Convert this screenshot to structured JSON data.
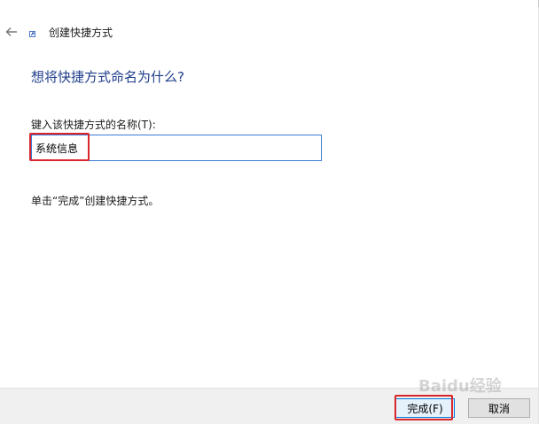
{
  "header": {
    "title": "创建快捷方式",
    "back_icon": "arrow-left-icon",
    "shortcut_icon": "shortcut-icon"
  },
  "main": {
    "question": "想将快捷方式命名为什么?",
    "field_label": "键入该快捷方式的名称(T):",
    "name_value": "系统信息",
    "hint": "单击“完成”创建快捷方式。"
  },
  "footer": {
    "finish_label": "完成(F)",
    "cancel_label": "取消"
  },
  "watermark": {
    "text": "Baidu经验"
  },
  "colors": {
    "question": "#1f3d8a",
    "input_border": "#3a7bd5",
    "highlight": "#d9252b",
    "footer_bg": "#f0f0f0"
  }
}
